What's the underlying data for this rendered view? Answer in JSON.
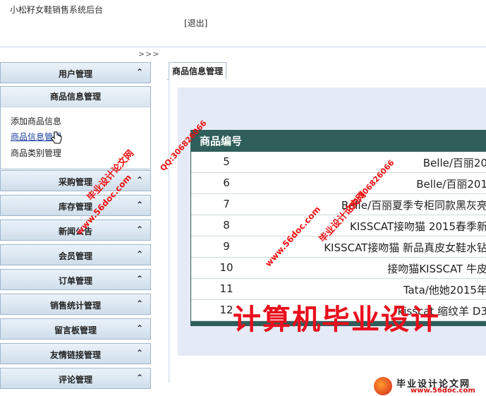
{
  "header": {
    "app_title": "小松籽女鞋销售系统后台",
    "logout_label": "[退出]",
    "toggle_label": ">>>"
  },
  "sidebar": {
    "menus": [
      {
        "label": "用户管理"
      },
      {
        "label": "商品信息管理"
      },
      {
        "label": "采购管理"
      },
      {
        "label": "库存管理"
      },
      {
        "label": "新闻公告"
      },
      {
        "label": "会员管理"
      },
      {
        "label": "订单管理"
      },
      {
        "label": "销售统计管理"
      },
      {
        "label": "留言板管理"
      },
      {
        "label": "友情链接管理"
      },
      {
        "label": "评论管理"
      }
    ],
    "submenu_items": [
      {
        "label": "添加商品信息"
      },
      {
        "label": "商品信息管理"
      },
      {
        "label": "商品类别管理"
      }
    ],
    "chevron": "⌃"
  },
  "main": {
    "tab_label": "商品信息管理",
    "table": {
      "header": "商品编号",
      "rows": [
        {
          "id": "5",
          "name": "Belle/百丽20"
        },
        {
          "id": "6",
          "name": "Belle/百丽201"
        },
        {
          "id": "7",
          "name": "Belle/百丽夏季专柜同款黑灰亮"
        },
        {
          "id": "8",
          "name": "KISSCAT接吻猫 2015春季新"
        },
        {
          "id": "9",
          "name": "KISSCAT接吻猫 新品真皮女鞋水钻"
        },
        {
          "id": "10",
          "name": "接吻猫KISSCAT 牛皮"
        },
        {
          "id": "11",
          "name": "Tata/他她2015年"
        },
        {
          "id": "12",
          "name": "kisscat 缩纹羊 D3"
        }
      ]
    }
  },
  "watermarks": {
    "big": "计算机毕业设计",
    "w1": "毕业设计论文网",
    "w2": "www.56doc.com",
    "w3": "QQ:306826066",
    "w4": "毕业设计论文网",
    "w5": "www.56doc.com",
    "w6": "QQ:306826066"
  },
  "footer_logo": {
    "title": "毕业设计论文网",
    "url": "www.56doc.com"
  }
}
